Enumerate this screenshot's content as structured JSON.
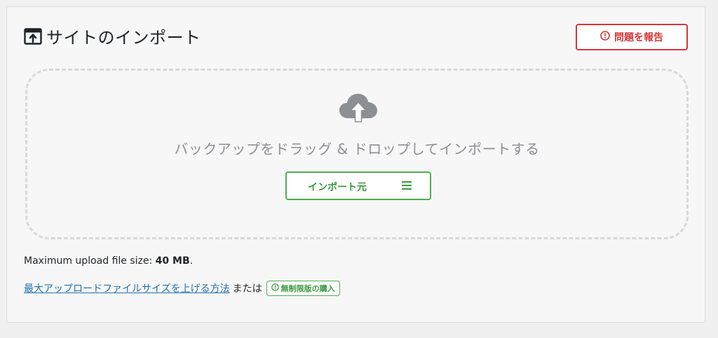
{
  "header": {
    "title": "サイトのインポート",
    "icon": "import-window-icon"
  },
  "report_button": {
    "label": "問題を報告",
    "icon": "exclamation-circle-icon",
    "color": "#d63638"
  },
  "dropzone": {
    "icon": "cloud-upload-icon",
    "text": "バックアップをドラッグ & ドロップしてインポートする",
    "import_button": {
      "label": "インポート元",
      "icon": "hamburger-menu-icon",
      "color": "#4caf50"
    }
  },
  "upload_info": {
    "label": "Maximum upload file size:",
    "value": "40 MB",
    "suffix": "."
  },
  "help": {
    "link_text": "最大アップロードファイルサイズを上げる方法",
    "or_text": "または",
    "badge_label": "無制限版の購入",
    "badge_icon": "exclamation-circle-icon"
  }
}
